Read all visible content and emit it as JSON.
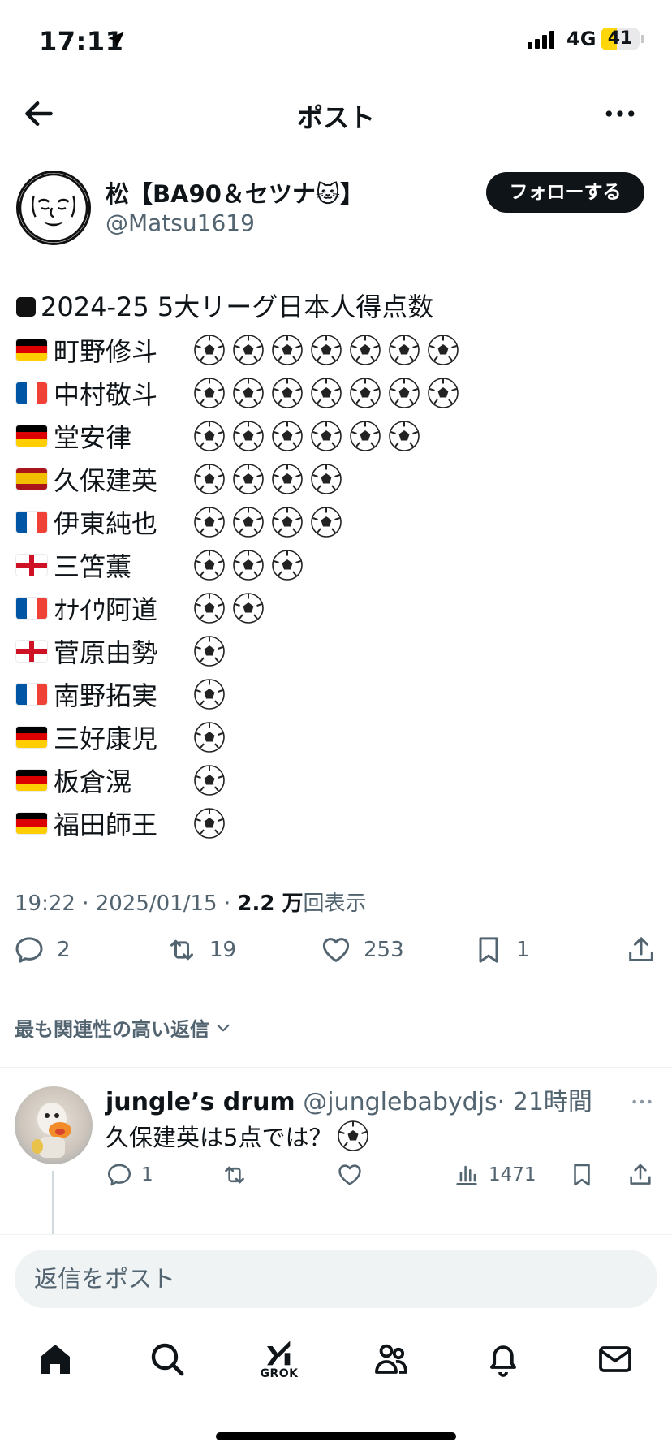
{
  "status_bar": {
    "time": "17:11",
    "network": "4G",
    "battery": "41",
    "battery_level": 0.41
  },
  "nav": {
    "title": "ポスト"
  },
  "author": {
    "name": "松【BA90＆セツナ🐱】",
    "handle": "@Matsu1619",
    "follow_label": "フォローする"
  },
  "tweet": {
    "heading": "2024-25  5大リーグ日本人得点数",
    "players": [
      {
        "flag": "de",
        "name": "町野修斗",
        "goals": 7
      },
      {
        "flag": "fr",
        "name": "中村敬斗",
        "goals": 7
      },
      {
        "flag": "de",
        "name": "堂安律",
        "goals": 6
      },
      {
        "flag": "es",
        "name": "久保建英",
        "goals": 4
      },
      {
        "flag": "fr",
        "name": "伊東純也",
        "goals": 4
      },
      {
        "flag": "en",
        "name": "三笘薫",
        "goals": 3
      },
      {
        "flag": "fr",
        "name": "ｵﾅｲｳ阿道",
        "goals": 2
      },
      {
        "flag": "en",
        "name": "菅原由勢",
        "goals": 1
      },
      {
        "flag": "fr",
        "name": "南野拓実",
        "goals": 1
      },
      {
        "flag": "de",
        "name": "三好康児",
        "goals": 1
      },
      {
        "flag": "de",
        "name": "板倉滉",
        "goals": 1
      },
      {
        "flag": "de",
        "name": "福田師王",
        "goals": 1
      }
    ],
    "meta": {
      "time_date": "19:22 · 2025/01/15 · ",
      "views_count": "2.2 万",
      "views_label": "回表示"
    },
    "stats": {
      "replies": "2",
      "reposts": "19",
      "likes": "253",
      "bookmarks": "1"
    }
  },
  "relevant_label": "最も関連性の高い返信",
  "reply": {
    "name": "jungle’s drum",
    "handle": "@junglebabydjs",
    "time": "· 21時間",
    "text": "久保建英は5点では？",
    "replies": "1",
    "views": "1471"
  },
  "composer": {
    "placeholder": "返信をポスト"
  },
  "tabbar": {
    "grok_label": "GROK"
  },
  "colors": {
    "text": "#0f1419",
    "secondary": "#536471",
    "battery": "#ffd60a",
    "flag_de": [
      "#000000",
      "#dd0000",
      "#ffce00"
    ],
    "flag_fr": [
      "#0055a4",
      "#ffffff",
      "#ef4135"
    ],
    "flag_es": [
      "#aa151b",
      "#f1bf00",
      "#aa151b"
    ],
    "flag_en": [
      "#ffffff",
      "#ce1124"
    ]
  }
}
